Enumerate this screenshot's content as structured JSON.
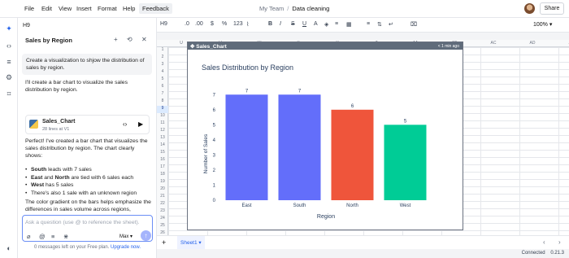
{
  "menu": [
    "File",
    "Edit",
    "View",
    "Insert",
    "Format",
    "Help",
    "Feedback"
  ],
  "breadcrumb": {
    "team": "My Team",
    "separator": "/",
    "doc": "Data cleaning"
  },
  "share_label": "Share",
  "cell_ref": "H9",
  "toolbar": {
    "decimals_down": ".0",
    ".00": ".00",
    "dollar": "$",
    "percent": "%",
    "format123": "123",
    "bold": "B",
    "italic": "I",
    "strike": "S",
    "underline": "U",
    "zoom": "100%"
  },
  "chat": {
    "title": "Sales by Region",
    "user_message": "Create a visualization to shjow the distribution of sales by region.",
    "assistant_intro": "I'll create a bar chart to visualize the sales distribution by region.",
    "artifact": {
      "title": "Sales_Chart",
      "subtitle": "28 lines at V1"
    },
    "assistant_summary": "Perfect! I've created a bar chart that visualizes the sales distribution by region. The chart clearly shows:",
    "bullets": [
      {
        "bold": "South",
        "rest": " leads with 7 sales"
      },
      {
        "bold": "East",
        "mid": " and ",
        "bold2": "North",
        "rest": " are tied with 6 sales each"
      },
      {
        "bold": "West",
        "rest": " has 5 sales"
      },
      {
        "bold": "",
        "rest": "There's also 1 sale with an unknown region"
      }
    ],
    "closing": "The color gradient on the bars helps emphasize the differences in sales volume across regions,",
    "input_placeholder": "Ask a question (use @ to reference the sheet).",
    "model": "Max",
    "footer_prefix": "0 messages left on your Free plan.",
    "footer_link": "Upgrade now."
  },
  "grid": {
    "columns": [
      "U",
      "V",
      "W",
      "X",
      "Y",
      "Z",
      "AA",
      "AB",
      "AC",
      "AD",
      "AE"
    ],
    "rows": [
      "1",
      "2",
      "3",
      "4",
      "5",
      "6",
      "7",
      "8",
      "9",
      "10",
      "11",
      "12",
      "13",
      "14",
      "15",
      "16",
      "17",
      "18",
      "19",
      "20",
      "21",
      "22",
      "23",
      "24",
      "25",
      "26"
    ],
    "selected_row": "9"
  },
  "chart_panel": {
    "title": "Sales_Chart",
    "age": "< 1 min ago"
  },
  "chart_data": {
    "type": "bar",
    "title": "Sales Distribution by Region",
    "xlabel": "Region",
    "ylabel": "Number of Sales",
    "categories": [
      "East",
      "South",
      "North",
      "West"
    ],
    "values": [
      7,
      7,
      6,
      5
    ],
    "colors": [
      "#636efa",
      "#636efa",
      "#ef553b",
      "#00cc96"
    ],
    "ylim": [
      0,
      7.5
    ],
    "yticks": [
      "0",
      "1",
      "2",
      "3",
      "4",
      "5",
      "6",
      "7"
    ]
  },
  "sheet_tab": "Sheet1",
  "status": {
    "connected": "Connected",
    "version": "0.21.3"
  }
}
